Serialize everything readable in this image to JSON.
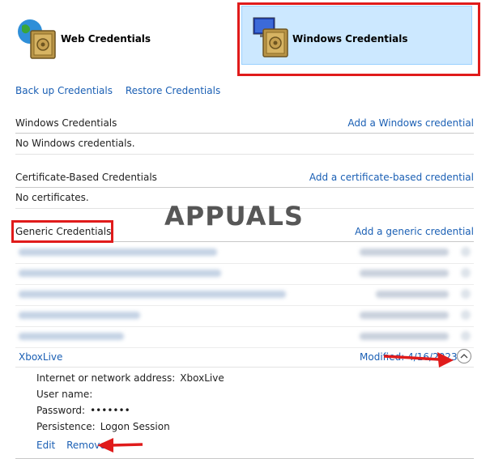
{
  "tabs": {
    "web": {
      "label": "Web Credentials"
    },
    "windows": {
      "label": "Windows Credentials",
      "selected": true
    }
  },
  "top_links": {
    "backup": "Back up Credentials",
    "restore": "Restore Credentials"
  },
  "sections": {
    "windows": {
      "title": "Windows Credentials",
      "add_link": "Add a Windows credential",
      "empty_text": "No Windows credentials."
    },
    "certificate": {
      "title": "Certificate-Based Credentials",
      "add_link": "Add a certificate-based credential",
      "empty_text": "No certificates."
    },
    "generic": {
      "title": "Generic Credentials",
      "add_link": "Add a generic credential"
    }
  },
  "expanded_credential": {
    "name": "XboxLive",
    "modified_prefix": "Modified:",
    "modified_date": "4/16/2023",
    "address_label": "Internet or network address:",
    "address_value": "XboxLive",
    "username_label": "User name:",
    "password_label": "Password:",
    "password_value": "•••••••",
    "persistence_label": "Persistence:",
    "persistence_value": "Logon Session",
    "edit_link": "Edit",
    "remove_link": "Remove"
  },
  "watermark": "APPUALS",
  "colors": {
    "link": "#1a5fb4",
    "selected_tab_bg": "#cce8ff",
    "highlight_red": "#e01b1b"
  },
  "icons": {
    "web": "globe-vault-icon",
    "windows": "monitor-vault-icon",
    "expand": "chevron-up-icon",
    "annotation": "red-arrow-icon"
  }
}
